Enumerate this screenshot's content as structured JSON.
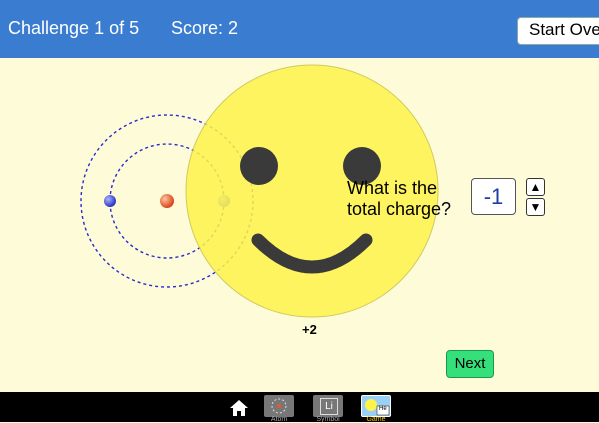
{
  "header": {
    "challenge": "Challenge 1 of 5",
    "score": "Score: 2",
    "start_over": "Start Over"
  },
  "question": {
    "text": "What is the\ntotal charge?",
    "answer": "-1"
  },
  "nucleus": {
    "charge_label": "+2"
  },
  "next_label": "Next",
  "nav": {
    "tabs": [
      {
        "label": "Atom"
      },
      {
        "label": "Symbol"
      },
      {
        "label": "Game",
        "selected": true,
        "icon_text": "He"
      }
    ],
    "symbol_icon_text": "Li"
  },
  "colors": {
    "header_bg": "#3a7ccf",
    "background": "#fdfbd8",
    "smiley": "#fff34a",
    "next": "#35e07a",
    "electron": "#3b44d6",
    "proton": "#e85a2a"
  }
}
